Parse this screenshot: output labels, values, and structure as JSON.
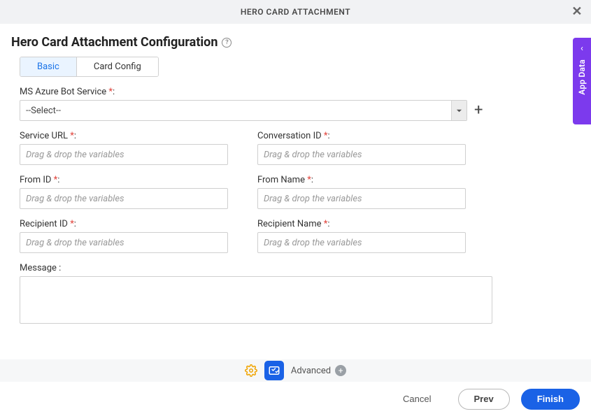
{
  "titlebar": {
    "title": "HERO CARD ATTACHMENT"
  },
  "heading": "Hero Card Attachment Configuration",
  "tabs": {
    "basic": "Basic",
    "cardConfig": "Card Config"
  },
  "form": {
    "botService": {
      "label": "MS Azure Bot Service",
      "value": "--Select--"
    },
    "placeholder": "Drag & drop the variables",
    "fields": {
      "serviceUrl": "Service URL",
      "conversationId": "Conversation ID",
      "fromId": "From ID",
      "fromName": "From Name",
      "recipientId": "Recipient ID",
      "recipientName": "Recipient Name",
      "message": "Message :"
    },
    "required": "*",
    "colon": ":"
  },
  "midbar": {
    "advanced": "Advanced"
  },
  "footer": {
    "cancel": "Cancel",
    "prev": "Prev",
    "finish": "Finish"
  },
  "sidepanel": {
    "label": "App Data"
  }
}
